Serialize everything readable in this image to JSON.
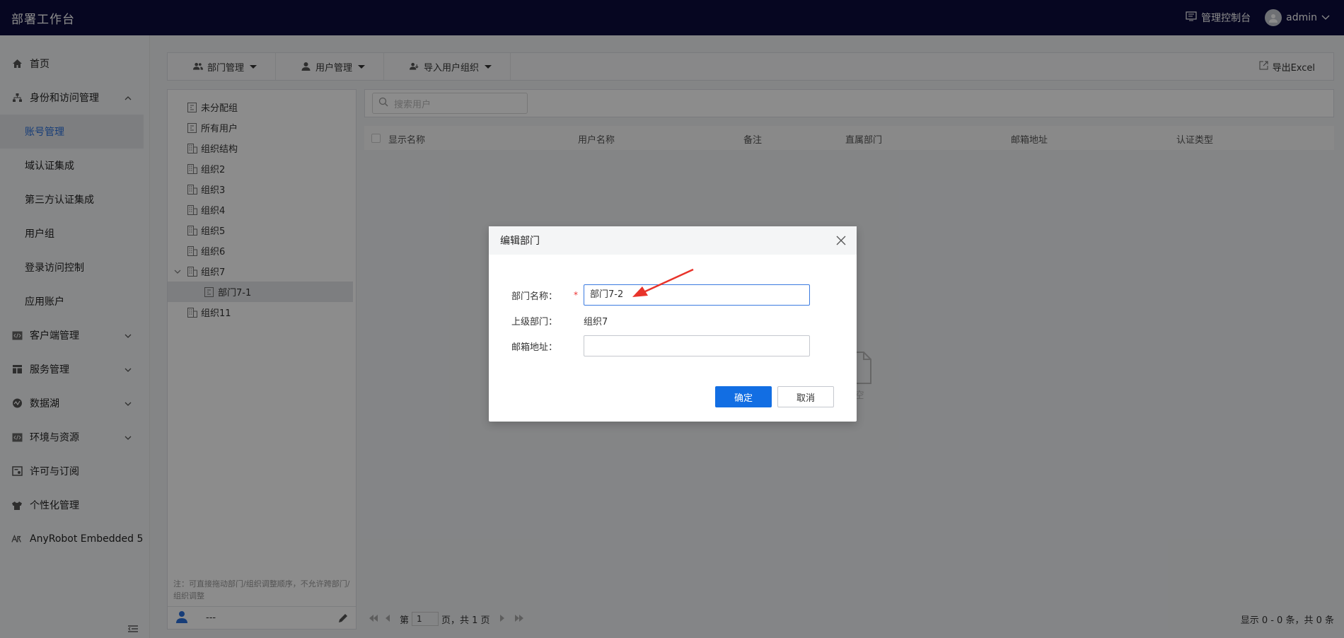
{
  "header": {
    "title": "部署工作台",
    "console_label": "管理控制台",
    "user": "admin"
  },
  "sidebar": {
    "items": [
      {
        "label": "首页",
        "icon": "home-icon"
      },
      {
        "label": "身份和访问管理",
        "icon": "org-icon",
        "expanded": true,
        "children": [
          "账号管理",
          "域认证集成",
          "第三方认证集成",
          "用户组",
          "登录访问控制",
          "应用账户"
        ]
      },
      {
        "label": "客户端管理",
        "icon": "code-icon"
      },
      {
        "label": "服务管理",
        "icon": "layout-icon"
      },
      {
        "label": "数据湖",
        "icon": "data-icon"
      },
      {
        "label": "环境与资源",
        "icon": "code-icon"
      },
      {
        "label": "许可与订阅",
        "icon": "license-icon"
      },
      {
        "label": "个性化管理",
        "icon": "shirt-icon"
      },
      {
        "label": "AnyRobot Embedded 5",
        "icon": "anyrobot-icon"
      }
    ],
    "active_child": "账号管理"
  },
  "toolbar": {
    "dept_label": "部门管理",
    "user_label": "用户管理",
    "import_label": "导入用户组织",
    "export_label": "导出Excel"
  },
  "tree": {
    "items": [
      "未分配组",
      "所有用户",
      "组织结构",
      "组织2",
      "组织3",
      "组织4",
      "组织5",
      "组织6",
      "组织7",
      "部门7-1",
      "组织11"
    ],
    "note": "注：可直接拖动部门/组织调整顺序，不允许跨部门/组织调整",
    "footer_text": "---"
  },
  "list": {
    "search_placeholder": "搜索用户",
    "columns": [
      "显示名称",
      "用户名称",
      "备注",
      "直属部门",
      "邮箱地址",
      "认证类型"
    ],
    "empty_text": "空"
  },
  "pager": {
    "prefix": "第",
    "page": "1",
    "suffix": "页，共 1 页",
    "info": "显示 0 - 0 条，共 0 条"
  },
  "dialog": {
    "title": "编辑部门",
    "name_label": "部门名称：",
    "name_value": "部门7-2",
    "parent_label": "上级部门：",
    "parent_value": "组织7",
    "email_label": "邮箱地址：",
    "email_value": "",
    "required_mark": "*",
    "ok_label": "确定",
    "cancel_label": "取消"
  },
  "colors": {
    "topbar": "#0b0b3d",
    "primary": "#126ee3",
    "annotation_arrow": "#e8332a"
  }
}
